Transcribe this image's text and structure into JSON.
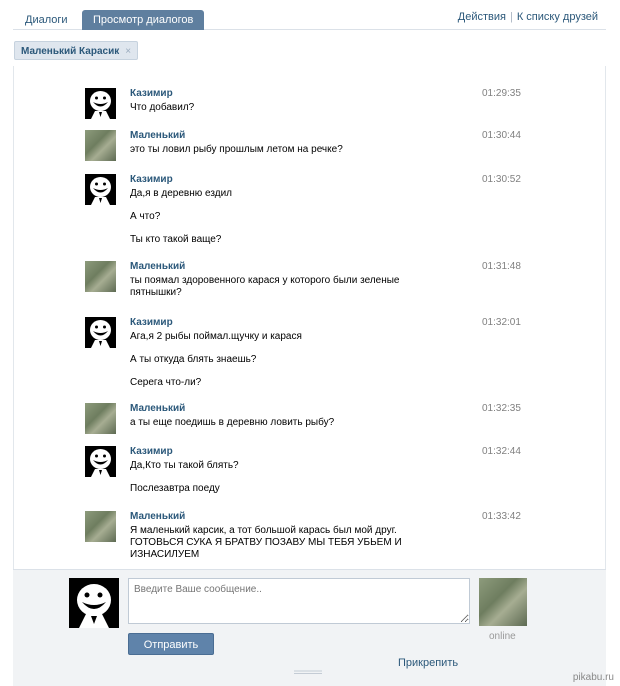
{
  "tabs": {
    "dialogs": "Диалоги",
    "view": "Просмотр диалогов",
    "actions": "Действия",
    "friends": "К списку друзей"
  },
  "chip": {
    "label": "Маленький Карасик",
    "close": "×"
  },
  "messages": [
    {
      "author": "Казимир",
      "time": "01:29:35",
      "avatar": "trollface-icon",
      "lines": [
        "Что добавил?"
      ]
    },
    {
      "author": "Маленький",
      "time": "01:30:44",
      "avatar": "fish-avatar",
      "lines": [
        "это ты ловил рыбу прошлым летом на речке?"
      ]
    },
    {
      "author": "Казимир",
      "time": "01:30:52",
      "avatar": "trollface-icon",
      "lines": [
        "Да,я в деревню ездил",
        "А что?",
        "Ты кто такой ваще?"
      ]
    },
    {
      "author": "Маленький",
      "time": "01:31:48",
      "avatar": "fish-avatar",
      "lines": [
        "ты поямал здоровенного карася у которого были зеленые пятнышки?"
      ]
    },
    {
      "author": "Казимир",
      "time": "01:32:01",
      "avatar": "trollface-icon",
      "lines": [
        "Ага,я 2 рыбы поймал.щучку и карася",
        "А ты откуда блять знаешь?",
        "Серега что-ли?"
      ]
    },
    {
      "author": "Маленький",
      "time": "01:32:35",
      "avatar": "fish-avatar",
      "lines": [
        "а ты еще поедишь в деревню ловить рыбу?"
      ]
    },
    {
      "author": "Казимир",
      "time": "01:32:44",
      "avatar": "trollface-icon",
      "lines": [
        "Да,Кто ты такой блять?",
        "Послезавтра поеду"
      ]
    },
    {
      "author": "Маленький",
      "time": "01:33:42",
      "avatar": "fish-avatar",
      "lines": [
        "Я маленький карсик, а тот большой карась был мой друг. ГОТОВЬСЯ СУКА Я БРАТВУ ПОЗАВУ МЫ ТЕБЯ УБЬЕМ И ИЗНАСИЛУЕМ"
      ]
    }
  ],
  "compose": {
    "placeholder": "Введите Ваше сообщение..",
    "send": "Отправить",
    "attach": "Прикрепить",
    "online": "online"
  },
  "watermark": "pikabu.ru",
  "colors": {
    "link": "#2b587a",
    "button": "#5f83aa",
    "active_tab": "#5f7f9f"
  }
}
